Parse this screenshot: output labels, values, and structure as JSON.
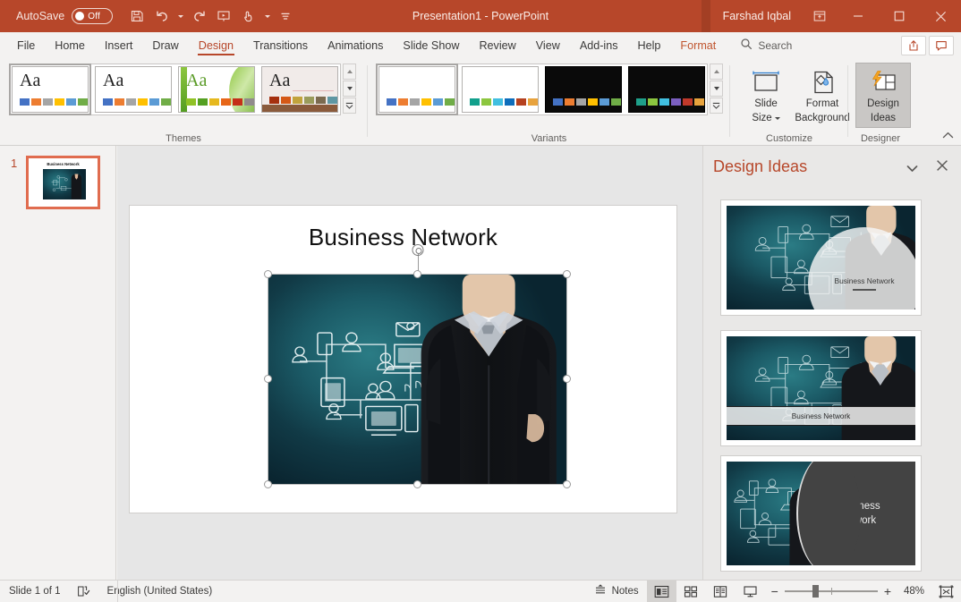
{
  "titlebar": {
    "autosave_label": "AutoSave",
    "autosave_state": "Off",
    "window_title": "Presentation1  -  PowerPoint",
    "account_name": "Farshad Iqbal",
    "quick_access": [
      {
        "name": "save-icon",
        "label": "Save"
      },
      {
        "name": "undo-icon",
        "label": "Undo"
      },
      {
        "name": "redo-icon",
        "label": "Redo"
      },
      {
        "name": "start-presentation-icon",
        "label": "Start From Beginning"
      },
      {
        "name": "touch-mouse-mode-icon",
        "label": "Touch/Mouse Mode"
      },
      {
        "name": "customize-quick-access-icon",
        "label": "Customize Quick Access Toolbar"
      }
    ],
    "window_controls": [
      {
        "name": "ribbon-display-options-icon",
        "label": "Ribbon Display Options"
      },
      {
        "name": "minimize-icon",
        "label": "Minimize"
      },
      {
        "name": "maximize-icon",
        "label": "Maximize"
      },
      {
        "name": "close-icon",
        "label": "Close"
      }
    ],
    "colors": {
      "bar": "#b7472a",
      "accent": "#b7472a"
    }
  },
  "tabs": [
    {
      "label": "File",
      "active": false
    },
    {
      "label": "Home",
      "active": false
    },
    {
      "label": "Insert",
      "active": false
    },
    {
      "label": "Draw",
      "active": false
    },
    {
      "label": "Design",
      "active": true
    },
    {
      "label": "Transitions",
      "active": false
    },
    {
      "label": "Animations",
      "active": false
    },
    {
      "label": "Slide Show",
      "active": false
    },
    {
      "label": "Review",
      "active": false
    },
    {
      "label": "View",
      "active": false
    },
    {
      "label": "Add-ins",
      "active": false
    },
    {
      "label": "Help",
      "active": false
    },
    {
      "label": "Format",
      "active": false,
      "contextual": true
    }
  ],
  "search": {
    "placeholder": "Search",
    "label": "Search",
    "icon": "search-icon"
  },
  "tab_right_buttons": [
    {
      "name": "share-button",
      "label": "Share",
      "icon": "share-icon"
    },
    {
      "name": "comments-button",
      "label": "Comments",
      "icon": "comment-icon"
    }
  ],
  "ribbon": {
    "groups": [
      {
        "name": "themes",
        "label": "Themes"
      },
      {
        "name": "variants",
        "label": "Variants"
      },
      {
        "name": "customize",
        "label": "Customize"
      },
      {
        "name": "designer",
        "label": "Designer"
      }
    ],
    "themes": [
      {
        "name": "theme-office",
        "selected": true,
        "aa": "Aa",
        "swatches": [
          "#4472c4",
          "#ed7d31",
          "#a5a5a5",
          "#ffc000",
          "#5b9bd5",
          "#70ad47"
        ]
      },
      {
        "name": "theme-office-2",
        "selected": false,
        "aa": "Aa",
        "swatches": [
          "#4472c4",
          "#ed7d31",
          "#a5a5a5",
          "#ffc000",
          "#5b9bd5",
          "#70ad47"
        ]
      },
      {
        "name": "theme-facet",
        "selected": false,
        "aa": "Aa",
        "swatches": [
          "#90c226",
          "#54a021",
          "#e6b91e",
          "#e76618",
          "#c42f19",
          "#918b8c"
        ]
      },
      {
        "name": "theme-wisp",
        "selected": false,
        "aa": "Aa",
        "swatches": [
          "#a5300f",
          "#d55816",
          "#c1a33c",
          "#9a9b5b",
          "#7b6a4f",
          "#5f97a3"
        ]
      }
    ],
    "variants": [
      {
        "name": "variant-1",
        "selected": true,
        "dark": false,
        "swatches": [
          "#4472c4",
          "#ed7d31",
          "#a5a5a5",
          "#ffc000",
          "#5b9bd5",
          "#70ad47"
        ]
      },
      {
        "name": "variant-2",
        "selected": false,
        "dark": false,
        "swatches": [
          "#12a08c",
          "#8cc63f",
          "#41bfe0",
          "#0d6dbb",
          "#b5411f",
          "#e8a33d"
        ]
      },
      {
        "name": "variant-3",
        "selected": false,
        "dark": true,
        "swatches": [
          "#4472c4",
          "#ed7d31",
          "#a5a5a5",
          "#ffc000",
          "#5b9bd5",
          "#70ad47"
        ]
      },
      {
        "name": "variant-4",
        "selected": false,
        "dark": true,
        "swatches": [
          "#1fa08a",
          "#8cc63f",
          "#41bfe0",
          "#7b5fc0",
          "#c0392b",
          "#e8a33d"
        ]
      }
    ],
    "buttons": {
      "slide_size": "Slide\nSize",
      "slide_size_line1": "Slide",
      "slide_size_line2": "Size",
      "format_background_line1": "Format",
      "format_background_line2": "Background",
      "design_ideas_line1": "Design",
      "design_ideas_line2": "Ideas"
    },
    "collapse_label": "Collapse the Ribbon"
  },
  "thumbnail_pane": {
    "slide_number": "1",
    "slide_title": "Business Network"
  },
  "slide": {
    "title": "Business Network",
    "picture_alt": "businessman drawing network diagram",
    "selected": true
  },
  "design_ideas": {
    "title": "Design Ideas",
    "caret_icon": "chevron-down-icon",
    "close_icon": "close-icon",
    "ideas": [
      {
        "name": "design-idea-1",
        "layout": "circle-overlay",
        "text": "Business Network"
      },
      {
        "name": "design-idea-2",
        "layout": "banner-band",
        "text": "Business Network"
      },
      {
        "name": "design-idea-3",
        "layout": "split-panel",
        "text_line1": "Business",
        "text_line2": "Network"
      }
    ]
  },
  "statusbar": {
    "slide_indicator": "Slide 1 of 1",
    "accessibility_icon": "accessibility-checker-icon",
    "language": "English (United States)",
    "notes_label": "Notes",
    "views": [
      {
        "name": "normal-view-button",
        "label": "Normal",
        "active": true
      },
      {
        "name": "slide-sorter-button",
        "label": "Slide Sorter",
        "active": false
      },
      {
        "name": "reading-view-button",
        "label": "Reading View",
        "active": false
      },
      {
        "name": "slide-show-button",
        "label": "Slide Show",
        "active": false
      }
    ],
    "zoom_out": "−",
    "zoom_in": "+",
    "zoom_level": "48%",
    "fit_label": "Fit slide to current window"
  }
}
